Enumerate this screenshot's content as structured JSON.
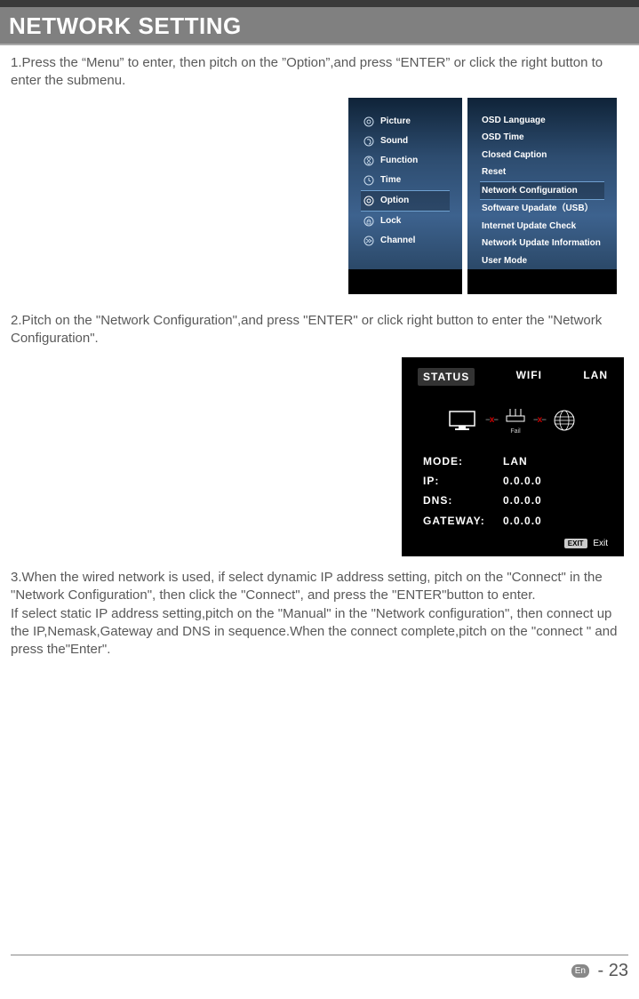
{
  "title": "NETWORK SETTING",
  "step1": "1.Press the “Menu” to enter, then pitch on the ”Option”,and press “ENTER” or click the right button to enter the submenu.",
  "menu_left": {
    "items": [
      "Picture",
      "Sound",
      "Function",
      "Time",
      "Option",
      "Lock",
      "Channel"
    ],
    "selected_index": 4
  },
  "menu_right": {
    "items": [
      "OSD Language",
      "OSD Time",
      "Closed Caption",
      "Reset",
      "Network Configuration",
      "Software Upadate（USB）",
      "Internet Update Check",
      "Network Update Information",
      "User Mode"
    ],
    "selected_index": 4
  },
  "step2": "2.Pitch on the \"Network Configuration\",and press \"ENTER\" or click right button to enter the \"Network Configuration\".",
  "status": {
    "tabs": [
      "STATUS",
      "WIFI",
      "LAN"
    ],
    "selected_tab": 0,
    "diagram_fail": "Fail",
    "rows": [
      {
        "k": "MODE:",
        "v": "LAN"
      },
      {
        "k": "IP:",
        "v": "0.0.0.0"
      },
      {
        "k": "DNS:",
        "v": "0.0.0.0"
      },
      {
        "k": "GATEWAY:",
        "v": "0.0.0.0"
      }
    ],
    "exit_btn": "EXIT",
    "exit_label": "Exit"
  },
  "step3": "3.When the wired network is used, if select dynamic IP address setting, pitch on the \"Connect\" in the \"Network Configuration\", then  click the \"Connect\", and press the \"ENTER\"button to enter.\nIf select static IP address setting,pitch on the \"Manual\" in the \"Network configuration\", then connect up the IP,Nemask,Gateway and DNS in sequence.When the connect complete,pitch on the \"connect \" and press the\"Enter\".",
  "footer": {
    "lang": "En",
    "sep": "-",
    "page": "23"
  }
}
